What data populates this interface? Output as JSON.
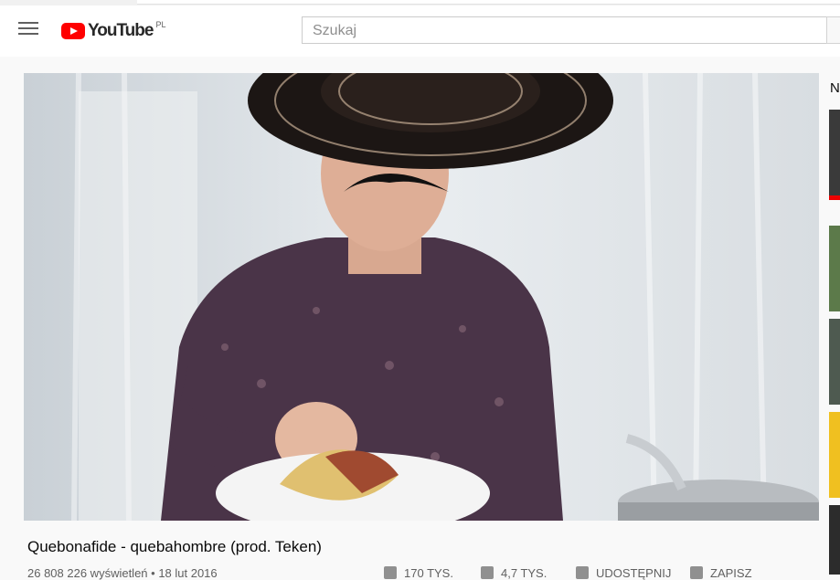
{
  "header": {
    "logo_text": "YouTube",
    "country_code": "PL",
    "search_placeholder": "Szukaj"
  },
  "video": {
    "title": "Quebonafide - quebahombre (prod. Teken)",
    "views": "26 808 226 wyświetleń",
    "date": "18 lut 2016",
    "likes": "170 TYS.",
    "dislikes": "4,7 TYS.",
    "share_label": "UDOSTĘPNIJ",
    "save_label": "ZAPISZ"
  },
  "sidebar": {
    "heading_partial": "N"
  },
  "colors": {
    "brand_red": "#ff0000",
    "page_bg": "#f9f9f9"
  }
}
